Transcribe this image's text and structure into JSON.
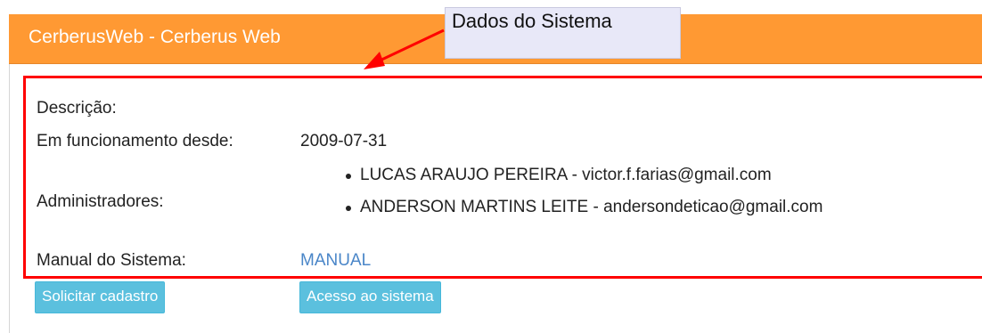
{
  "panel": {
    "title": "CerberusWeb - Cerberus Web",
    "header_color": "#ff9933"
  },
  "callout": {
    "text": "Dados do Sistema",
    "arrow_color": "#ff0000"
  },
  "details": {
    "description_label": "Descrição:",
    "description_value": "",
    "since_label": "Em funcionamento desde:",
    "since_value": "2009-07-31",
    "admins_label": "Administradores:",
    "admins": [
      "LUCAS ARAUJO PEREIRA - victor.f.farias@gmail.com",
      "ANDERSON MARTINS LEITE - andersondeticao@gmail.com"
    ],
    "manual_label": "Manual do Sistema:",
    "manual_link": "MANUAL"
  },
  "actions": {
    "register_label": "Solicitar cadastro",
    "access_label": "Acesso ao sistema",
    "button_color": "#5bc0de"
  }
}
